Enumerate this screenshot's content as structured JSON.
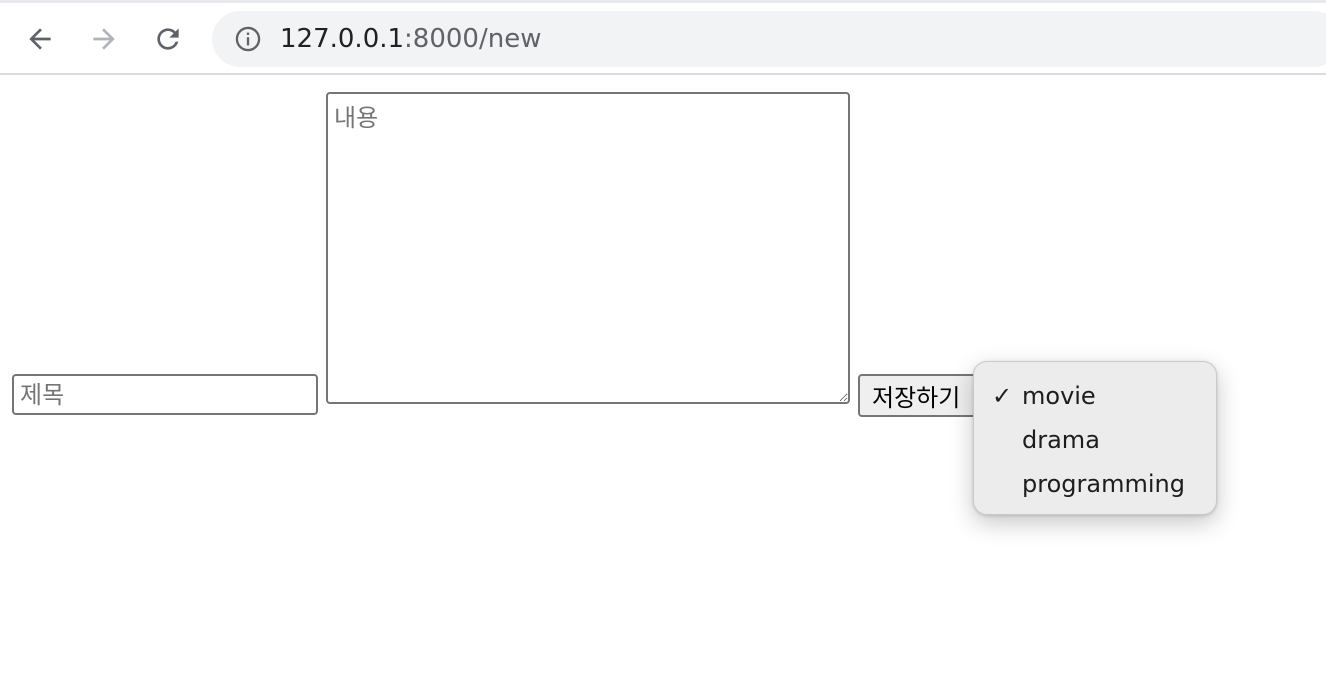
{
  "browser": {
    "url_host": "127.0.0.1",
    "url_path": ":8000/new",
    "icons": {
      "back": "back-arrow-icon",
      "forward": "forward-arrow-icon",
      "reload": "reload-icon",
      "site_info": "info-icon"
    }
  },
  "form": {
    "title_placeholder": "제목",
    "title_value": "",
    "content_placeholder": "내용",
    "content_value": "",
    "save_label": "저장하기"
  },
  "category_select": {
    "selected": "movie",
    "check_mark": "✓",
    "options": [
      {
        "label": "movie"
      },
      {
        "label": "drama"
      },
      {
        "label": "programming"
      }
    ]
  }
}
